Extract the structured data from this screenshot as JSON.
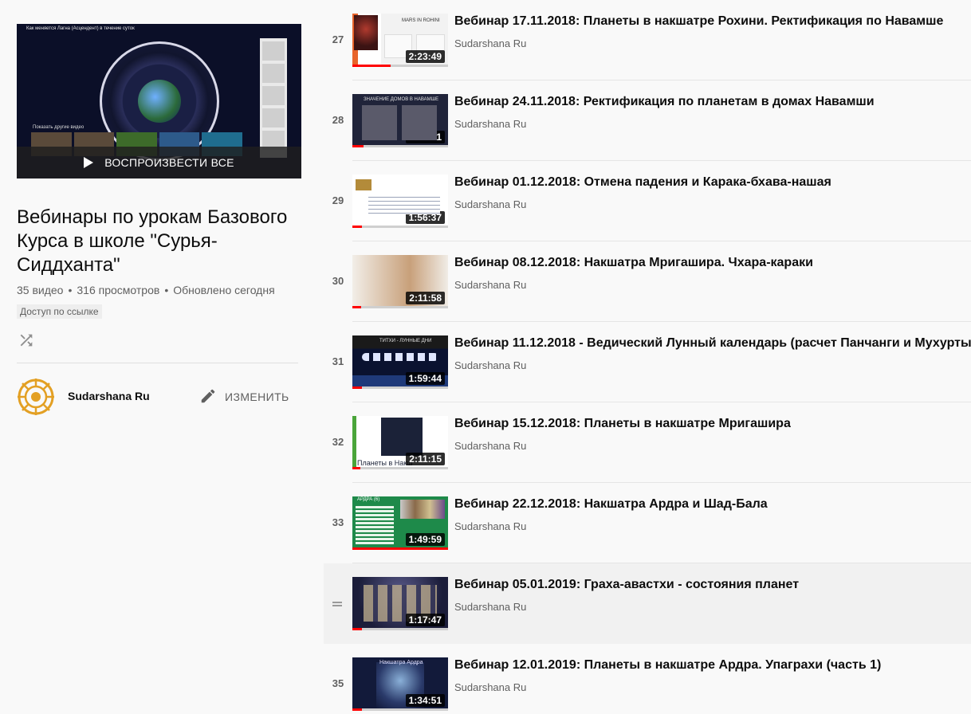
{
  "playlist": {
    "play_all_label": "ВОСПРОИЗВЕСТИ ВСЕ",
    "hero_caption_top": "Как меняется Лагна (Асцендент) в течение суток",
    "hero_caption_more": "Показать другие видео",
    "title": "Вебинары по урокам Базового Курса в школе \"Сурья-Сиддханта\"",
    "video_count": "35 видео",
    "views": "316 просмотров",
    "updated": "Обновлено сегодня",
    "privacy": "Доступ по ссылке",
    "shuffle_icon": "shuffle-icon",
    "owner_name": "Sudarshana Ru",
    "edit_label": "ИЗМЕНИТЬ",
    "edit_icon": "pencil-icon",
    "separator": "•"
  },
  "videos": [
    {
      "index": "27",
      "title": "Вебинар 17.11.2018: Планеты в накшатре Рохини. Ректификация по Навамше",
      "channel": "Sudarshana Ru",
      "duration": "2:23:49",
      "thumb_text": "MARS IN ROHINI"
    },
    {
      "index": "28",
      "title": "Вебинар 24.11.2018: Ректификация по планетам в домах Навамши",
      "channel": "Sudarshana Ru",
      "duration": "2:01:51",
      "thumb_text": "ЗНАЧЕНИЕ ДОМОВ В НАВАМШЕ"
    },
    {
      "index": "29",
      "title": "Вебинар 01.12.2018: Отмена падения и Карака-бхава-нашая",
      "channel": "Sudarshana Ru",
      "duration": "1:56:37",
      "thumb_text": ""
    },
    {
      "index": "30",
      "title": "Вебинар 08.12.2018: Накшатра Мригашира. Чхара-караки",
      "channel": "Sudarshana Ru",
      "duration": "2:11:58",
      "thumb_text": ""
    },
    {
      "index": "31",
      "title": "Вебинар 11.12.2018 - Ведический Лунный календарь (расчет Панчанги и Мухурты)",
      "channel": "Sudarshana Ru",
      "duration": "1:59:44",
      "thumb_text": "ТИТХИ - ЛУННЫЕ ДНИ"
    },
    {
      "index": "32",
      "title": "Вебинар 15.12.2018: Планеты в накшатре Мригашира",
      "channel": "Sudarshana Ru",
      "duration": "2:11:15",
      "thumb_text": "Планеты в Накш"
    },
    {
      "index": "33",
      "title": "Вебинар 22.12.2018: Накшатра Ардра и Шад-Бала",
      "channel": "Sudarshana Ru",
      "duration": "1:49:59",
      "thumb_text": "АРДРА (6)"
    },
    {
      "index": "",
      "title": "Вебинар 05.01.2019: Граха-авастхи - состояния планет",
      "channel": "Sudarshana Ru",
      "duration": "1:17:47",
      "thumb_text": "",
      "active": true
    },
    {
      "index": "35",
      "title": "Вебинар 12.01.2019: Планеты в накшатре Ардра. Упаграхи (часть 1)",
      "channel": "Sudarshana Ru",
      "duration": "1:34:51",
      "thumb_text": "Накшатра Ардра"
    }
  ],
  "colors": {
    "progress": "#ff0000",
    "text_secondary": "#606060",
    "active_row": "#f1f1f1"
  }
}
